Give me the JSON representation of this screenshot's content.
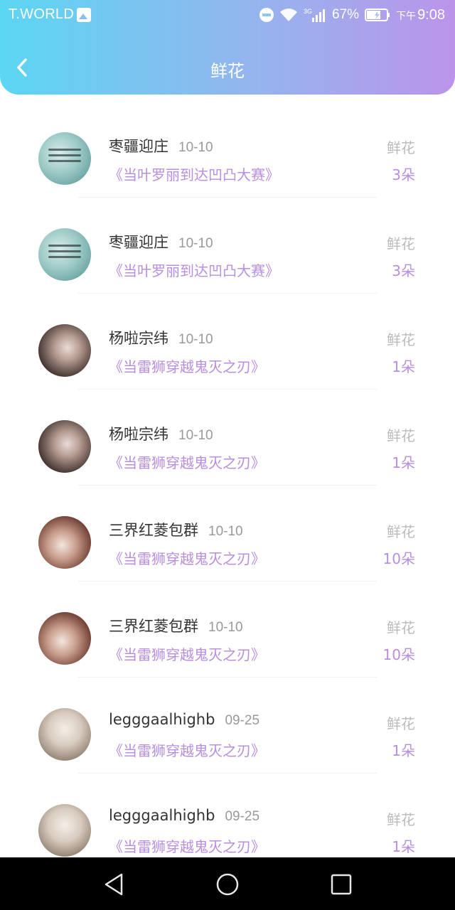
{
  "status_bar": {
    "carrier": "T.WORLD",
    "network": "3G",
    "battery": "67%",
    "time_prefix": "下午",
    "time": "9:08"
  },
  "header": {
    "title": "鲜花"
  },
  "items": [
    {
      "name": "枣疆迎庄",
      "date": "10-10",
      "match": "《当叶罗丽到达凹凸大赛》",
      "gift": "鲜花",
      "count": "3朵"
    },
    {
      "name": "枣疆迎庄",
      "date": "10-10",
      "match": "《当叶罗丽到达凹凸大赛》",
      "gift": "鲜花",
      "count": "3朵"
    },
    {
      "name": "杨啦宗纬",
      "date": "10-10",
      "match": "《当雷狮穿越鬼灭之刃》",
      "gift": "鲜花",
      "count": "1朵"
    },
    {
      "name": "杨啦宗纬",
      "date": "10-10",
      "match": "《当雷狮穿越鬼灭之刃》",
      "gift": "鲜花",
      "count": "1朵"
    },
    {
      "name": "三界红菱包群",
      "date": "10-10",
      "match": "《当雷狮穿越鬼灭之刃》",
      "gift": "鲜花",
      "count": "10朵"
    },
    {
      "name": "三界红菱包群",
      "date": "10-10",
      "match": "《当雷狮穿越鬼灭之刃》",
      "gift": "鲜花",
      "count": "10朵"
    },
    {
      "name": "legggaalhighb",
      "date": "09-25",
      "match": "《当雷狮穿越鬼灭之刃》",
      "gift": "鲜花",
      "count": "1朵"
    },
    {
      "name": "legggaalhighb",
      "date": "09-25",
      "match": "《当雷狮穿越鬼灭之刃》",
      "gift": "鲜花",
      "count": "1朵"
    }
  ],
  "icons": {
    "back": "chevron-left-icon",
    "nav_back": "triangle-back-icon",
    "nav_home": "circle-home-icon",
    "nav_recent": "square-recent-icon"
  },
  "colors": {
    "header_gradient_start": "#5bd6f3",
    "header_gradient_end": "#bb94ea",
    "accent_purple": "#b88ee0",
    "name_text": "#333333",
    "muted_text": "#999999"
  }
}
